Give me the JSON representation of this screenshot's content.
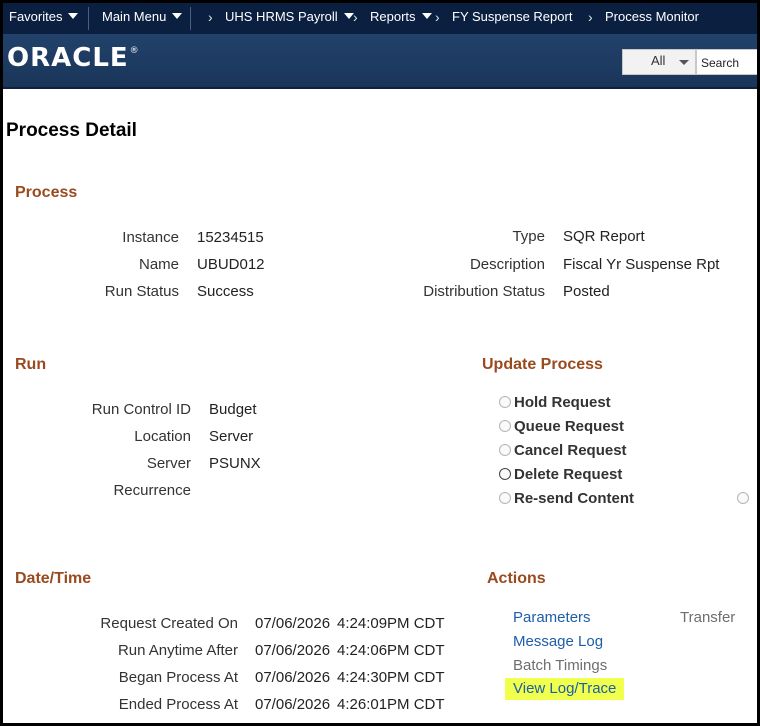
{
  "nav": {
    "favorites": "Favorites",
    "main_menu": "Main Menu",
    "breadcrumbs": [
      "UHS HRMS Payroll",
      "Reports",
      "FY Suspense Report",
      "Process Monitor"
    ]
  },
  "banner": {
    "logo": "ORACLE",
    "logo_mark": "®",
    "search_scope": "All",
    "search_placeholder": "Search"
  },
  "page_title": "Process Detail",
  "process": {
    "heading": "Process",
    "instance_label": "Instance",
    "instance": "15234515",
    "name_label": "Name",
    "name": "UBUD012",
    "run_status_label": "Run Status",
    "run_status": "Success",
    "type_label": "Type",
    "type": "SQR Report",
    "description_label": "Description",
    "description": "Fiscal Yr Suspense Rpt",
    "distribution_status_label": "Distribution Status",
    "distribution_status": "Posted"
  },
  "run": {
    "heading": "Run",
    "run_control_id_label": "Run Control ID",
    "run_control_id": "Budget",
    "location_label": "Location",
    "location": "Server",
    "server_label": "Server",
    "server": "PSUNX",
    "recurrence_label": "Recurrence",
    "recurrence": ""
  },
  "update_process": {
    "heading": "Update Process",
    "options": [
      "Hold Request",
      "Queue Request",
      "Cancel Request",
      "Delete Request",
      "Re-send Content"
    ]
  },
  "datetime": {
    "heading": "Date/Time",
    "rows": [
      {
        "label": "Request Created On",
        "date": "07/06/2026",
        "time": "4:24:09PM CDT"
      },
      {
        "label": "Run Anytime After",
        "date": "07/06/2026",
        "time": "4:24:06PM CDT"
      },
      {
        "label": "Began Process At",
        "date": "07/06/2026",
        "time": "4:24:30PM CDT"
      },
      {
        "label": "Ended Process At",
        "date": "07/06/2026",
        "time": "4:26:01PM CDT"
      }
    ]
  },
  "actions": {
    "heading": "Actions",
    "parameters": "Parameters",
    "transfer": "Transfer",
    "message_log": "Message Log",
    "batch_timings": "Batch Timings",
    "view_log_trace": "View Log/Trace"
  },
  "colors": {
    "nav_bg": "#0b2040",
    "banner_bg": "#1f3d66",
    "section_heading": "#9a4a1f",
    "link": "#1c5ea8",
    "highlight": "#f1ff4d"
  }
}
